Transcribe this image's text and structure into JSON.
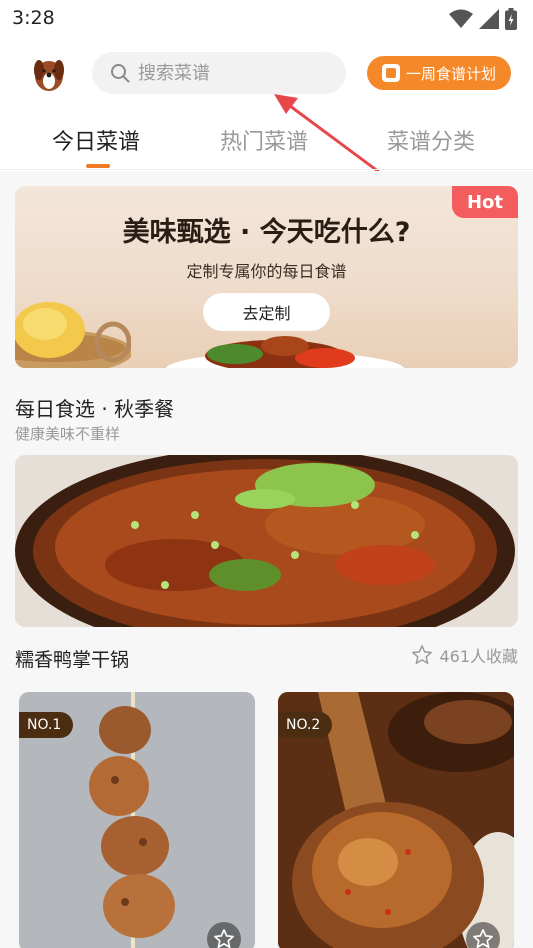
{
  "status_bar": {
    "time": "3:28",
    "icons": [
      "wifi-icon",
      "signal-icon",
      "battery-icon"
    ]
  },
  "header": {
    "search": {
      "placeholder": "搜索菜谱"
    },
    "plan_button": {
      "label": "一周食谱计划"
    }
  },
  "tabs": [
    {
      "label": "今日菜谱",
      "active": true
    },
    {
      "label": "热门菜谱",
      "active": false
    },
    {
      "label": "菜谱分类",
      "active": false
    }
  ],
  "banner": {
    "badge": "Hot",
    "title": "美味甄选 · 今天吃什么?",
    "subtitle": "定制专属你的每日食谱",
    "button_label": "去定制"
  },
  "daily_section": {
    "title": "每日食选 · 秋季餐",
    "subtitle": "健康美味不重样"
  },
  "featured_recipe": {
    "name": "糯香鸭掌干锅",
    "favorites": "461人收藏"
  },
  "ranked_recipes": [
    {
      "rank": "NO.1"
    },
    {
      "rank": "NO.2"
    }
  ],
  "colors": {
    "accent": "#f27c25",
    "plan_button": "#f5892a",
    "hot_badge": "#f35d5d",
    "rank_badge": "#4b2d12",
    "annotation_arrow": "#e8474a"
  }
}
